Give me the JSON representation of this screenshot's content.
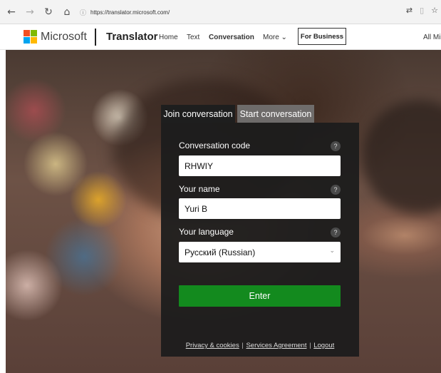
{
  "browser": {
    "back": "←",
    "forward": "→",
    "refresh": "↻",
    "home": "⌂",
    "url": "https://translator.microsoft.com/"
  },
  "header": {
    "microsoft": "Microsoft",
    "brand": "Translator",
    "nav": [
      "Home",
      "Text",
      "Conversation",
      "More ⌄"
    ],
    "for_business": "For Business",
    "all_microsoft": "All Mi"
  },
  "dialog": {
    "tabs": [
      "Join conversation",
      "Start conversation"
    ],
    "active_tab": "Join conversation",
    "fields": [
      {
        "label": "Conversation code",
        "help": "?",
        "value": "RHWIY"
      },
      {
        "label": "Your name",
        "help": "?",
        "value": "Yuri B"
      },
      {
        "label": "Your language",
        "help": "?",
        "value": "Русский (Russian)"
      }
    ],
    "enter_label": "Enter",
    "footer": {
      "privacy": "Privacy & cookies",
      "services": "Services Agreement",
      "logout": "Logout",
      "separator": "|"
    }
  },
  "colors": {
    "enter_button": "#138a1e",
    "panel": "#1c1c1c"
  }
}
